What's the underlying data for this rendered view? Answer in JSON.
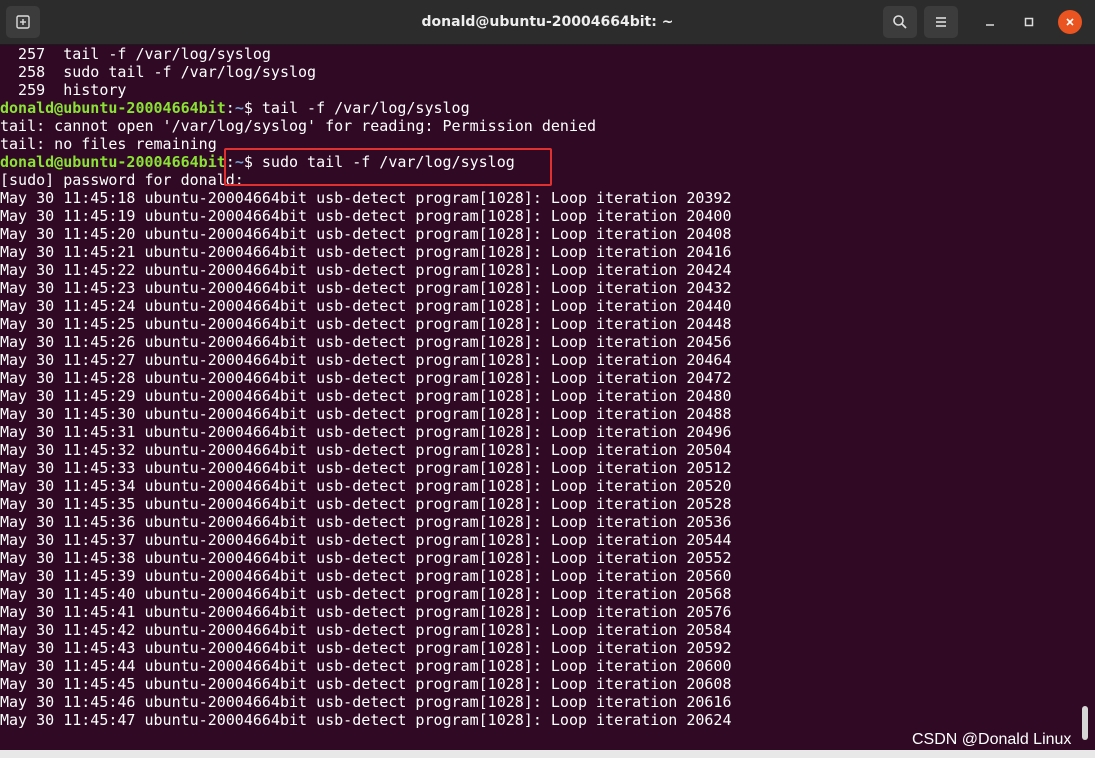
{
  "window": {
    "title": "donald@ubuntu-20004664bit: ~",
    "titlebar_color": "#2c2c2c",
    "close_button_color": "#e95420"
  },
  "terminal": {
    "background": "#300a24",
    "prompt_user_color": "#8ae234",
    "prompt_path_color": "#729fcf",
    "history_lines": [
      "  257  tail -f /var/log/syslog",
      "  258  sudo tail -f /var/log/syslog",
      "  259  history"
    ],
    "prompt_user": "donald@ubuntu-20004664bit",
    "prompt_colon": ":",
    "prompt_path": "~",
    "command_1": "$ tail -f /var/log/syslog",
    "error_lines": [
      "tail: cannot open '/var/log/syslog' for reading: Permission denied",
      "tail: no files remaining"
    ],
    "command_2": "$ sudo tail -f /var/log/syslog",
    "sudo_prompt": "[sudo] password for donald:",
    "log_lines": [
      "May 30 11:45:18 ubuntu-20004664bit usb-detect program[1028]: Loop iteration 20392",
      "May 30 11:45:19 ubuntu-20004664bit usb-detect program[1028]: Loop iteration 20400",
      "May 30 11:45:20 ubuntu-20004664bit usb-detect program[1028]: Loop iteration 20408",
      "May 30 11:45:21 ubuntu-20004664bit usb-detect program[1028]: Loop iteration 20416",
      "May 30 11:45:22 ubuntu-20004664bit usb-detect program[1028]: Loop iteration 20424",
      "May 30 11:45:23 ubuntu-20004664bit usb-detect program[1028]: Loop iteration 20432",
      "May 30 11:45:24 ubuntu-20004664bit usb-detect program[1028]: Loop iteration 20440",
      "May 30 11:45:25 ubuntu-20004664bit usb-detect program[1028]: Loop iteration 20448",
      "May 30 11:45:26 ubuntu-20004664bit usb-detect program[1028]: Loop iteration 20456",
      "May 30 11:45:27 ubuntu-20004664bit usb-detect program[1028]: Loop iteration 20464",
      "May 30 11:45:28 ubuntu-20004664bit usb-detect program[1028]: Loop iteration 20472",
      "May 30 11:45:29 ubuntu-20004664bit usb-detect program[1028]: Loop iteration 20480",
      "May 30 11:45:30 ubuntu-20004664bit usb-detect program[1028]: Loop iteration 20488",
      "May 30 11:45:31 ubuntu-20004664bit usb-detect program[1028]: Loop iteration 20496",
      "May 30 11:45:32 ubuntu-20004664bit usb-detect program[1028]: Loop iteration 20504",
      "May 30 11:45:33 ubuntu-20004664bit usb-detect program[1028]: Loop iteration 20512",
      "May 30 11:45:34 ubuntu-20004664bit usb-detect program[1028]: Loop iteration 20520",
      "May 30 11:45:35 ubuntu-20004664bit usb-detect program[1028]: Loop iteration 20528",
      "May 30 11:45:36 ubuntu-20004664bit usb-detect program[1028]: Loop iteration 20536",
      "May 30 11:45:37 ubuntu-20004664bit usb-detect program[1028]: Loop iteration 20544",
      "May 30 11:45:38 ubuntu-20004664bit usb-detect program[1028]: Loop iteration 20552",
      "May 30 11:45:39 ubuntu-20004664bit usb-detect program[1028]: Loop iteration 20560",
      "May 30 11:45:40 ubuntu-20004664bit usb-detect program[1028]: Loop iteration 20568",
      "May 30 11:45:41 ubuntu-20004664bit usb-detect program[1028]: Loop iteration 20576",
      "May 30 11:45:42 ubuntu-20004664bit usb-detect program[1028]: Loop iteration 20584",
      "May 30 11:45:43 ubuntu-20004664bit usb-detect program[1028]: Loop iteration 20592",
      "May 30 11:45:44 ubuntu-20004664bit usb-detect program[1028]: Loop iteration 20600",
      "May 30 11:45:45 ubuntu-20004664bit usb-detect program[1028]: Loop iteration 20608",
      "May 30 11:45:46 ubuntu-20004664bit usb-detect program[1028]: Loop iteration 20616",
      "May 30 11:45:47 ubuntu-20004664bit usb-detect program[1028]: Loop iteration 20624"
    ]
  },
  "annotation": {
    "highlight_color": "#e03030"
  },
  "watermark": {
    "text": "CSDN @Donald Linux"
  }
}
